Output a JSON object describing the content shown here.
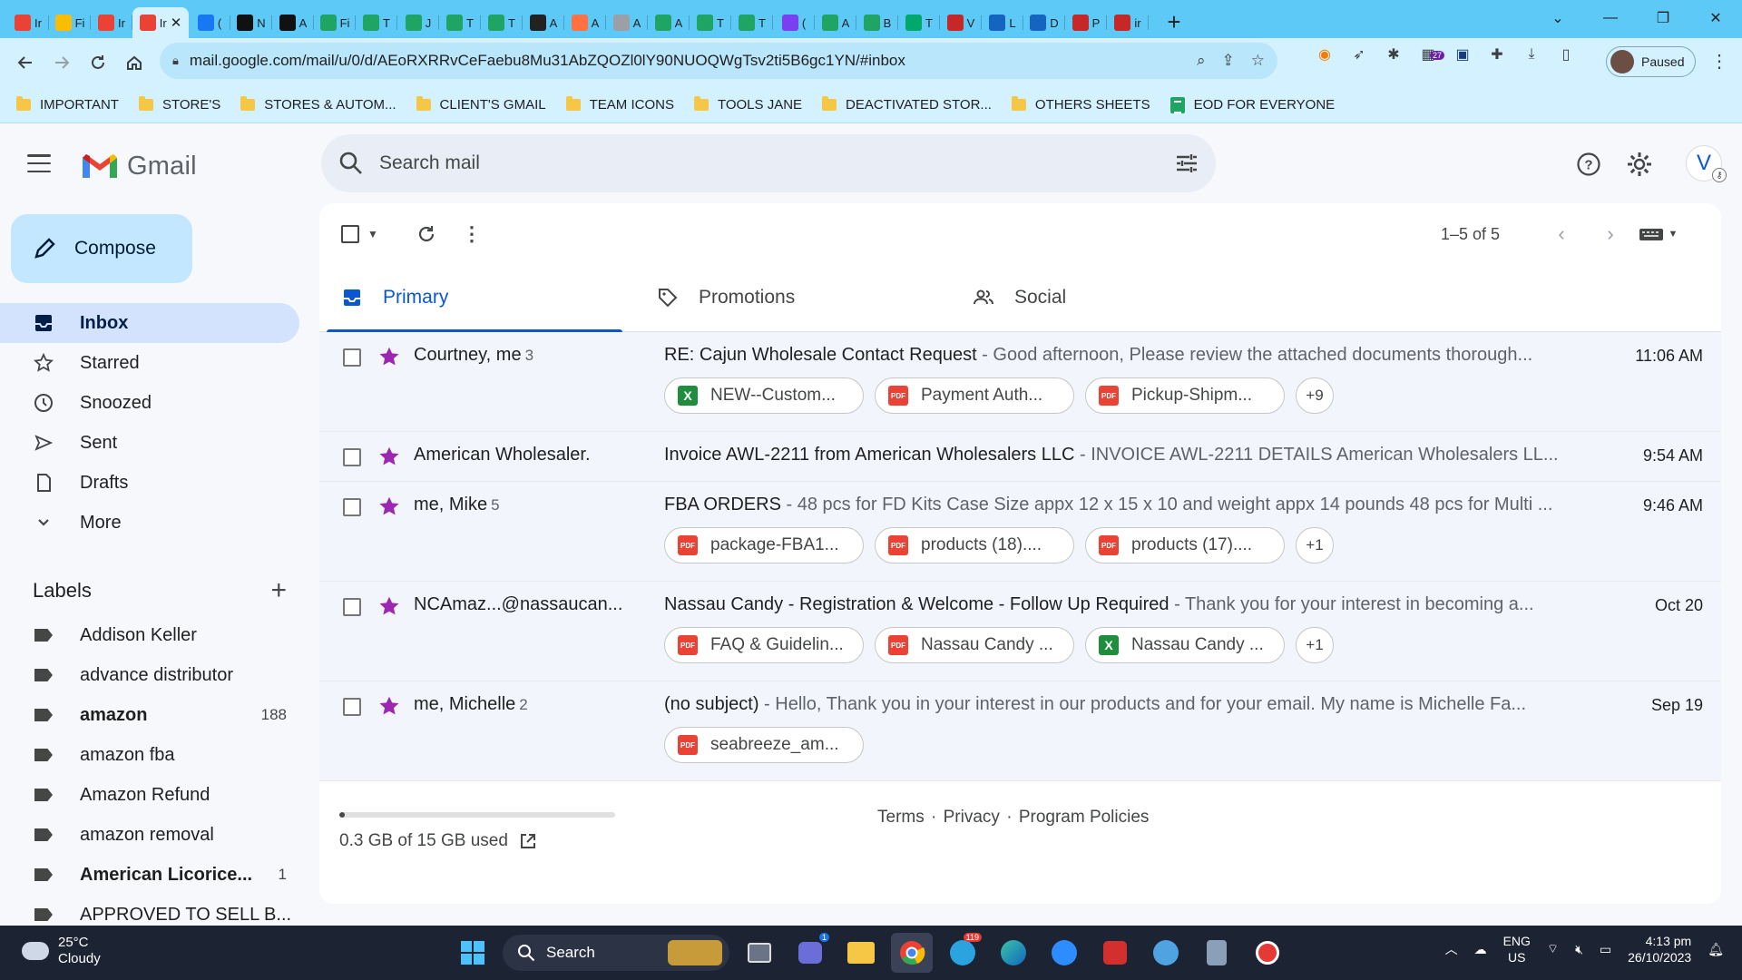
{
  "browser": {
    "tabs": [
      {
        "icon": "gmail-icon",
        "label": "Ir",
        "color": "#ea4335"
      },
      {
        "icon": "drive-icon",
        "label": "Fi",
        "color": "#fbbc04"
      },
      {
        "icon": "gmail-icon",
        "label": "Ir",
        "color": "#ea4335"
      },
      {
        "icon": "gmail-icon",
        "label": "Ir",
        "color": "#ea4335",
        "active": true
      },
      {
        "icon": "facebook-icon",
        "label": "(",
        "color": "#1877f2"
      },
      {
        "icon": "amazon-icon",
        "label": "N",
        "color": "#111111"
      },
      {
        "icon": "amazon-icon",
        "label": "A",
        "color": "#111111"
      },
      {
        "icon": "sheets-icon",
        "label": "Fi",
        "color": "#1fa463"
      },
      {
        "icon": "sheets-icon",
        "label": "T",
        "color": "#1fa463"
      },
      {
        "icon": "sheets-icon",
        "label": "J",
        "color": "#1fa463"
      },
      {
        "icon": "sheets-icon",
        "label": "T",
        "color": "#1fa463"
      },
      {
        "icon": "sheets-icon",
        "label": "T",
        "color": "#1fa463"
      },
      {
        "icon": "circle-c-icon",
        "label": "A",
        "color": "#222222"
      },
      {
        "icon": "pencil-icon",
        "label": "A",
        "color": "#ff7043"
      },
      {
        "icon": "grey-circle-icon",
        "label": "A",
        "color": "#9aa0a6"
      },
      {
        "icon": "sheets-icon",
        "label": "A",
        "color": "#1fa463"
      },
      {
        "icon": "sheets-icon",
        "label": "T",
        "color": "#1fa463"
      },
      {
        "icon": "sheets-icon",
        "label": "T",
        "color": "#1fa463"
      },
      {
        "icon": "messenger-icon",
        "label": "(",
        "color": "#7b3ff2"
      },
      {
        "icon": "sheets-icon",
        "label": "A",
        "color": "#1fa463"
      },
      {
        "icon": "sheets-icon",
        "label": "B",
        "color": "#1fa463"
      },
      {
        "icon": "w-icon",
        "label": "T",
        "color": "#00a86b"
      },
      {
        "icon": "w-red-icon",
        "label": "V",
        "color": "#c62828"
      },
      {
        "icon": "cloud-icon",
        "label": "L",
        "color": "#1565c0"
      },
      {
        "icon": "cloud-icon",
        "label": "D",
        "color": "#1565c0"
      },
      {
        "icon": "pdf-icon",
        "label": "P",
        "color": "#c62828"
      },
      {
        "icon": "v-icon",
        "label": "ir",
        "color": "#c62828"
      }
    ],
    "active_tab_close": "✕",
    "new_tab": "+",
    "url": "mail.google.com/mail/u/0/d/AEoRXRRvCeFaebu8Mu31AbZQOZl0lY90NUOQWgTsv2ti5B6gc1YN/#inbox",
    "ext_badge": "27",
    "profile_status": "Paused",
    "bookmarks": [
      {
        "label": "IMPORTANT",
        "type": "folder"
      },
      {
        "label": "STORE'S",
        "type": "folder"
      },
      {
        "label": "STORES & AUTOM...",
        "type": "folder"
      },
      {
        "label": "CLIENT'S GMAIL",
        "type": "folder"
      },
      {
        "label": "TEAM ICONS",
        "type": "folder"
      },
      {
        "label": "TOOLS JANE",
        "type": "folder"
      },
      {
        "label": "DEACTIVATED STOR...",
        "type": "folder"
      },
      {
        "label": "OTHERS SHEETS",
        "type": "folder"
      },
      {
        "label": "EOD FOR EVERYONE",
        "type": "sheet"
      }
    ]
  },
  "gmail": {
    "logo_text": "Gmail",
    "search_placeholder": "Search mail",
    "avatar_letter": "V",
    "compose_label": "Compose",
    "nav": [
      {
        "label": "Inbox",
        "icon": "inbox-icon",
        "active": true
      },
      {
        "label": "Starred",
        "icon": "star-outline-icon"
      },
      {
        "label": "Snoozed",
        "icon": "clock-icon"
      },
      {
        "label": "Sent",
        "icon": "send-icon"
      },
      {
        "label": "Drafts",
        "icon": "draft-icon"
      },
      {
        "label": "More",
        "icon": "chevron-down-icon"
      }
    ],
    "labels_title": "Labels",
    "labels": [
      {
        "name": "Addison Keller",
        "count": "",
        "bold": false
      },
      {
        "name": "advance distributor",
        "count": "",
        "bold": false
      },
      {
        "name": "amazon",
        "count": "188",
        "bold": true
      },
      {
        "name": "amazon fba",
        "count": "",
        "bold": false
      },
      {
        "name": "Amazon Refund",
        "count": "",
        "bold": false
      },
      {
        "name": "amazon removal",
        "count": "",
        "bold": false
      },
      {
        "name": "American Licorice...",
        "count": "1",
        "bold": true
      },
      {
        "name": "APPROVED TO SELL B...",
        "count": "",
        "bold": false
      }
    ],
    "pager": "1–5 of 5",
    "category_tabs": [
      {
        "label": "Primary",
        "icon": "inbox-tab-icon",
        "active": true
      },
      {
        "label": "Promotions",
        "icon": "tag-icon"
      },
      {
        "label": "Social",
        "icon": "people-icon"
      }
    ],
    "emails": [
      {
        "sender": "Courtney, me",
        "count": "3",
        "subject": "RE: Cajun Wholesale Contact Request",
        "snippet": " - Good afternoon, Please review the attached documents thorough...",
        "time": "11:06 AM",
        "attachments": [
          {
            "name": "NEW--Custom...",
            "type": "xls"
          },
          {
            "name": "Payment Auth...",
            "type": "pdf"
          },
          {
            "name": "Pickup-Shipm...",
            "type": "pdf"
          }
        ],
        "more": "+9"
      },
      {
        "sender": "American Wholesaler.",
        "count": "",
        "subject": "Invoice AWL-2211 from American Wholesalers LLC",
        "snippet": " - INVOICE AWL-2211 DETAILS American Wholesalers LL...",
        "time": "9:54 AM",
        "attachments": [],
        "more": ""
      },
      {
        "sender": "me, Mike",
        "count": "5",
        "subject": "FBA ORDERS",
        "snippet": " - 48 pcs for FD Kits Case Size appx 12 x 15 x 10 and weight appx 14 pounds 48 pcs for Multi ...",
        "time": "9:46 AM",
        "attachments": [
          {
            "name": "package-FBA1...",
            "type": "pdf"
          },
          {
            "name": "products (18)....",
            "type": "pdf"
          },
          {
            "name": "products (17)....",
            "type": "pdf"
          }
        ],
        "more": "+1"
      },
      {
        "sender": "NCAmaz...@nassaucan...",
        "count": "",
        "subject": "Nassau Candy - Registration & Welcome - Follow Up Required",
        "snippet": " - Thank you for your interest in becoming a...",
        "time": "Oct 20",
        "attachments": [
          {
            "name": "FAQ & Guidelin...",
            "type": "pdf"
          },
          {
            "name": "Nassau Candy ...",
            "type": "pdf"
          },
          {
            "name": "Nassau Candy ...",
            "type": "xls"
          }
        ],
        "more": "+1"
      },
      {
        "sender": "me, Michelle",
        "count": "2",
        "subject": "(no subject)",
        "snippet": " - Hello, Thank you in your interest in our products and for your email. My name is Michelle Fa...",
        "time": "Sep 19",
        "attachments": [
          {
            "name": "seabreeze_am...",
            "type": "pdf"
          }
        ],
        "more": ""
      }
    ],
    "storage_text": "0.3 GB of 15 GB used",
    "storage_fraction": 0.02,
    "footer_links": [
      "Terms",
      "Privacy",
      "Program Policies"
    ]
  },
  "taskbar": {
    "temperature": "25°C",
    "condition": "Cloudy",
    "search_label": "Search",
    "lang_line1": "ENG",
    "lang_line2": "US",
    "time": "4:13 pm",
    "date": "26/10/2023",
    "teams_badge": "1",
    "telegram_badge": "119"
  },
  "colors": {
    "accent": "#0b57d0",
    "star": "#9c27b0"
  }
}
